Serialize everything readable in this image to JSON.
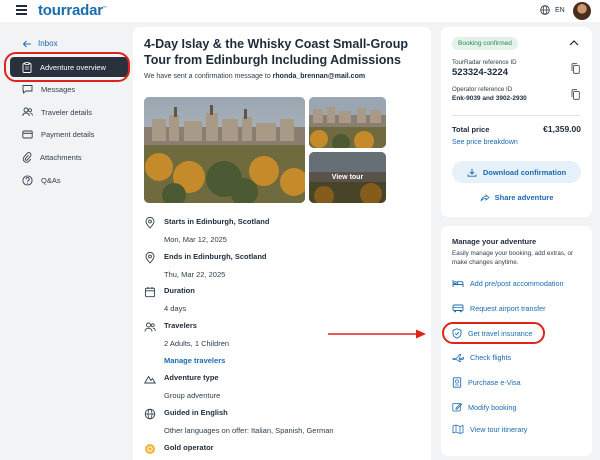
{
  "header": {
    "logo": "tourradar",
    "logo_mark": "™",
    "language": "EN",
    "icons": {
      "menu": "hamburger-icon",
      "globe": "globe-icon"
    }
  },
  "sidebar": {
    "back_label": "Inbox",
    "items": [
      {
        "label": "Adventure overview",
        "icon": "clipboard-icon",
        "active": true
      },
      {
        "label": "Messages",
        "icon": "messages-icon"
      },
      {
        "label": "Traveler details",
        "icon": "users-icon"
      },
      {
        "label": "Payment details",
        "icon": "card-icon"
      },
      {
        "label": "Attachments",
        "icon": "paperclip-icon"
      },
      {
        "label": "Q&As",
        "icon": "question-icon"
      }
    ]
  },
  "main": {
    "title": "4-Day Islay & the Whisky Coast Small-Group Tour from Edinburgh Including Admissions",
    "confirm_text": "We have sent a confirmation message to ",
    "confirm_email": "rhonda_brennan@mail.com",
    "view_tour_label": "View tour",
    "details": [
      {
        "label": "Starts in Edinburgh, Scotland",
        "sub": "Mon, Mar 12, 2025",
        "icon": "location-pin-icon"
      },
      {
        "label": "Ends in Edinburgh, Scotland",
        "sub": "Thu, Mar 22, 2025",
        "icon": "location-pin-icon"
      },
      {
        "label": "Duration",
        "sub": "4 days",
        "icon": "calendar-icon"
      },
      {
        "label": "Travelers",
        "sub": "2 Adults, 1 Children",
        "link": "Manage travelers",
        "icon": "users-icon"
      },
      {
        "label": "Adventure type",
        "sub": "Group adventure",
        "icon": "mountain-icon"
      },
      {
        "label": "Guided in English",
        "sub": "Other languages on offer: Italian, Spanish, German",
        "icon": "globe-icon"
      },
      {
        "label": "Gold operator",
        "icon": "gold-badge-icon"
      }
    ]
  },
  "booking": {
    "status": "Booking confirmed",
    "ref_label": "TourRadar reference ID",
    "ref_value": "523324-3224",
    "op_label": "Operator reference ID",
    "op_value": "Enk-9039 and 3902-2930",
    "total_label": "Total price",
    "total_value": "€1,359.00",
    "breakdown_link": "See price breakdown",
    "download_label": "Download confirmation",
    "share_label": "Share adventure"
  },
  "manage": {
    "title": "Manage your adventure",
    "description": "Easily manage your booking, add extras, or make changes anytime.",
    "actions": [
      {
        "label": "Add pre/post accommodation",
        "icon": "bed-icon"
      },
      {
        "label": "Request airport transfer",
        "icon": "bus-icon"
      },
      {
        "label": "Get travel insurance",
        "icon": "shield-icon"
      },
      {
        "label": "Check flights",
        "icon": "plane-icon"
      },
      {
        "label": "Purchase e-Visa",
        "icon": "passport-icon"
      },
      {
        "label": "Modify booking",
        "icon": "edit-icon"
      },
      {
        "label": "View tour itinerary",
        "icon": "map-icon"
      }
    ]
  },
  "colors": {
    "accent": "#1b6bb0",
    "highlight": "#e0221b",
    "sidebar_active": "#29323c",
    "badge_bg": "#e3f2ea",
    "badge_text": "#2a8a4f"
  }
}
